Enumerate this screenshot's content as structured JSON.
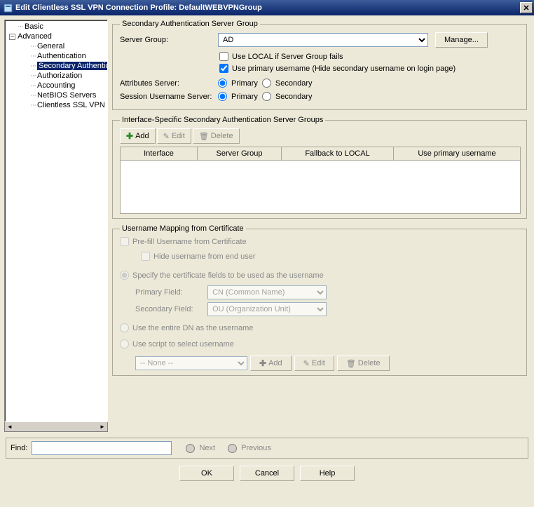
{
  "window": {
    "title": "Edit Clientless SSL VPN Connection Profile: DefaultWEBVPNGroup"
  },
  "tree": {
    "basic": "Basic",
    "advanced": "Advanced",
    "items": [
      "General",
      "Authentication",
      "Secondary Authentication",
      "Authorization",
      "Accounting",
      "NetBIOS Servers",
      "Clientless SSL VPN"
    ]
  },
  "sasg": {
    "legend": "Secondary Authentication Server Group",
    "serverGroupLabel": "Server Group:",
    "serverGroupValue": "AD",
    "manage": "Manage...",
    "useLocal": "Use LOCAL if Server Group fails",
    "usePrimaryUser": "Use primary username (Hide secondary username on login page)",
    "attrServerLabel": "Attributes Server:",
    "sessUserLabel": "Session Username Server:",
    "primary": "Primary",
    "secondary": "Secondary"
  },
  "ispec": {
    "legend": "Interface-Specific Secondary Authentication Server Groups",
    "add": "Add",
    "edit": "Edit",
    "delete": "Delete",
    "cols": [
      "Interface",
      "Server Group",
      "Fallback to LOCAL",
      "Use primary username"
    ]
  },
  "umap": {
    "legend": "Username Mapping from Certificate",
    "prefill": "Pre-fill Username from Certificate",
    "hideUser": "Hide username from end user",
    "specify": "Specify the certificate fields to be used as the username",
    "primaryField": "Primary Field:",
    "primaryValue": "CN (Common Name)",
    "secondaryField": "Secondary Field:",
    "secondaryValue": "OU (Organization Unit)",
    "useDN": "Use the entire DN as the username",
    "useScript": "Use script to select username",
    "scriptNone": "-- None --",
    "add": "Add",
    "edit": "Edit",
    "delete": "Delete"
  },
  "find": {
    "label": "Find:",
    "next": "Next",
    "previous": "Previous"
  },
  "footer": {
    "ok": "OK",
    "cancel": "Cancel",
    "help": "Help"
  }
}
